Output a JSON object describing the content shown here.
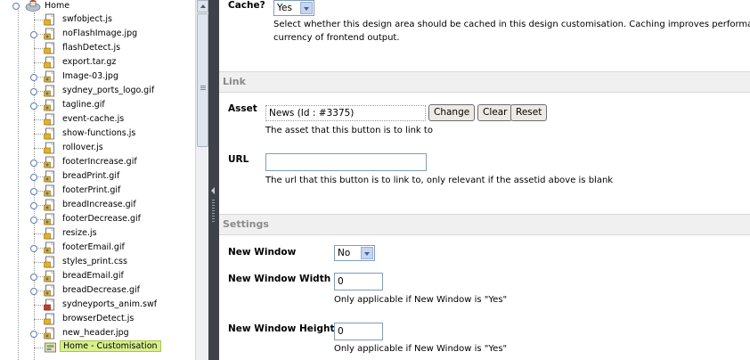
{
  "tree": {
    "root_label": "Home",
    "items": [
      {
        "label": "swfobject.js",
        "type": "js",
        "expandable": false
      },
      {
        "label": "noFlashImage.jpg",
        "type": "img",
        "expandable": true
      },
      {
        "label": "flashDetect.js",
        "type": "js",
        "expandable": false
      },
      {
        "label": "export.tar.gz",
        "type": "file",
        "expandable": false
      },
      {
        "label": "Image-03.jpg",
        "type": "img",
        "expandable": true
      },
      {
        "label": "sydney_ports_logo.gif",
        "type": "img",
        "expandable": true
      },
      {
        "label": "tagline.gif",
        "type": "img",
        "expandable": true
      },
      {
        "label": "event-cache.js",
        "type": "js",
        "expandable": false
      },
      {
        "label": "show-functions.js",
        "type": "js",
        "expandable": false
      },
      {
        "label": "rollover.js",
        "type": "js",
        "expandable": false
      },
      {
        "label": "footerIncrease.gif",
        "type": "img",
        "expandable": true
      },
      {
        "label": "breadPrint.gif",
        "type": "img",
        "expandable": true
      },
      {
        "label": "footerPrint.gif",
        "type": "img",
        "expandable": true
      },
      {
        "label": "breadIncrease.gif",
        "type": "img",
        "expandable": true
      },
      {
        "label": "footerDecrease.gif",
        "type": "img",
        "expandable": true
      },
      {
        "label": "resize.js",
        "type": "js",
        "expandable": false
      },
      {
        "label": "footerEmail.gif",
        "type": "img",
        "expandable": true
      },
      {
        "label": "styles_print.css",
        "type": "css",
        "expandable": false
      },
      {
        "label": "breadEmail.gif",
        "type": "img",
        "expandable": true
      },
      {
        "label": "breadDecrease.gif",
        "type": "img",
        "expandable": true
      },
      {
        "label": "sydneyports_anim.swf",
        "type": "swf",
        "expandable": false
      },
      {
        "label": "browserDetect.js",
        "type": "js",
        "expandable": false
      },
      {
        "label": "new_header.jpg",
        "type": "img",
        "expandable": true
      },
      {
        "label": "Home - Customisation",
        "type": "design",
        "expandable": false,
        "selected": true
      }
    ]
  },
  "cache": {
    "label": "Cache?",
    "value": "Yes",
    "note_line1": "Select whether this design area should be cached in this design customisation. Caching improves performance",
    "note_line2": "currency of frontend output."
  },
  "link_section": {
    "title": "Link",
    "asset_label": "Asset",
    "asset_value": "News (Id : #3375)",
    "change_button": "Change",
    "clear_button": "Clear",
    "reset_button": "Reset",
    "asset_note": "The asset that this button is to link to",
    "url_label": "URL",
    "url_value": "",
    "url_note": "The url that this button is to link to, only relevant if the assetid above is blank"
  },
  "settings_section": {
    "title": "Settings",
    "new_window_label": "New Window",
    "new_window_value": "No",
    "width_label": "New Window Width",
    "width_value": "0",
    "width_note": "Only applicable if New Window is \"Yes\"",
    "height_label": "New Window Height",
    "height_value": "0",
    "height_note": "Only applicable if New Window is \"Yes\""
  },
  "colors": {
    "splitter": "#3f4349",
    "section_header_bg": "#f0f0f0",
    "section_header_text": "#8a8a8a",
    "selected_item_bg": "#d8f08c"
  }
}
